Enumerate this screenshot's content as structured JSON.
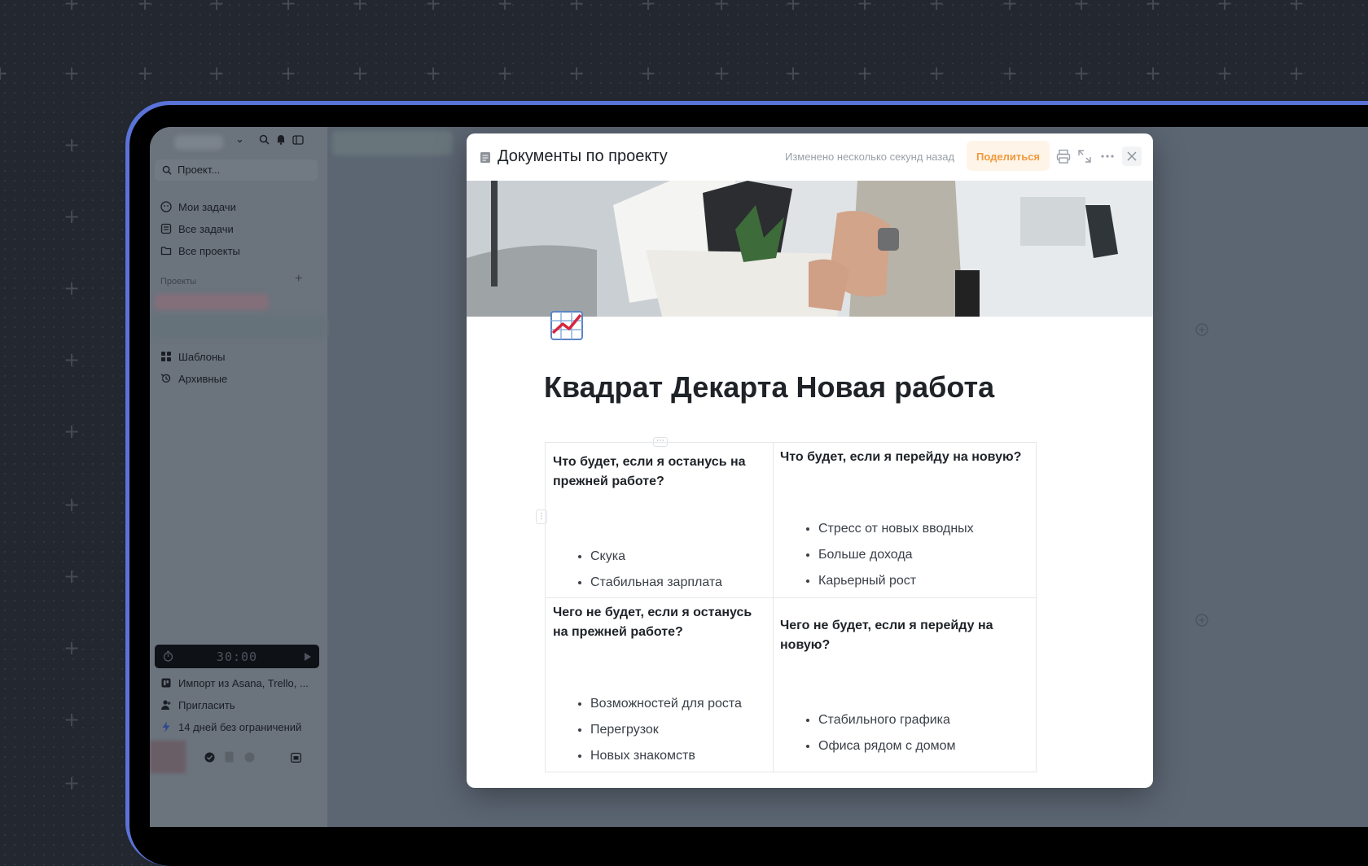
{
  "sidebar": {
    "search_placeholder": "Проект...",
    "nav": [
      {
        "label": "Мои задачи",
        "icon": "my-tasks-icon"
      },
      {
        "label": "Все задачи",
        "icon": "all-tasks-icon"
      },
      {
        "label": "Все проекты",
        "icon": "folder-icon"
      }
    ],
    "projects_header": "Проекты",
    "secondary": [
      {
        "label": "Шаблоны",
        "icon": "templates-icon"
      },
      {
        "label": "Архивные",
        "icon": "history-icon"
      }
    ],
    "timer": "30:00",
    "footer": [
      {
        "label": "Импорт из Asana, Trello, ...",
        "icon": "import-icon"
      },
      {
        "label": "Пригласить",
        "icon": "invite-icon"
      },
      {
        "label": "14 дней без ограничений",
        "icon": "lightning-icon"
      }
    ]
  },
  "modal": {
    "title": "Документы по проекту",
    "edited": "Изменено несколько секунд назад",
    "share": "Поделиться"
  },
  "document": {
    "emoji": "chart-increasing-icon",
    "title": "Квадрат Декарта Новая работа",
    "quadrants": [
      {
        "heading": "Что будет, если я останусь на прежней работе?",
        "items": [
          "Скука",
          "Стабильная зарплата"
        ]
      },
      {
        "heading": "Что будет, если я перейду на новую?",
        "items": [
          "Стресс от новых вводных",
          "Больше дохода",
          "Карьерный рост"
        ]
      },
      {
        "heading": "Чего не будет, если я останусь на прежней работе?",
        "items": [
          "Возможностей для роста",
          "Перегрузок",
          "Новых знакомств"
        ]
      },
      {
        "heading": "Чего не будет, если я перейду на новую?",
        "items": [
          "Стабильного графика",
          "Офиса рядом с домом"
        ]
      }
    ]
  },
  "colors": {
    "accent_share_bg": "#fff4e8",
    "accent_share_text": "#f09a3d",
    "device_frame": "#5a73d8",
    "background": "#23272f"
  }
}
